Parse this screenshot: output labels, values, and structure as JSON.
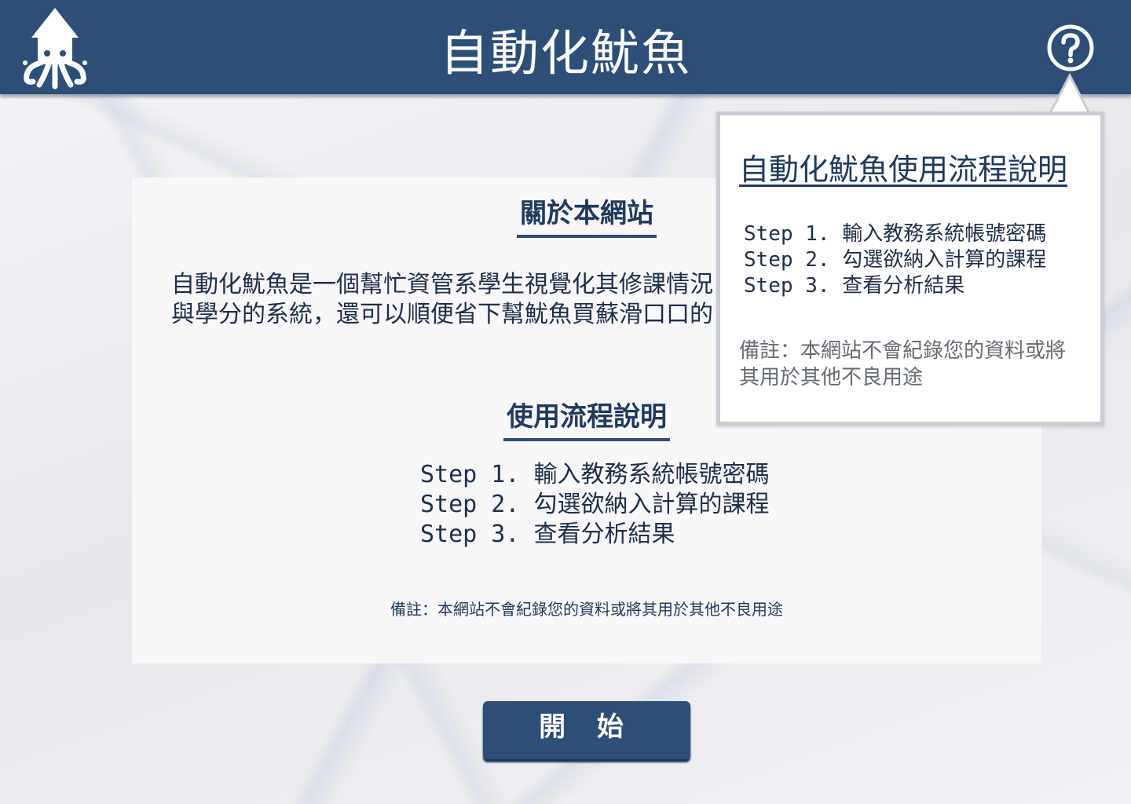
{
  "header": {
    "logo_icon": "squid-icon",
    "title": "自動化魷魚",
    "help_icon": "question-circle-icon",
    "background_color": "#2d4e76"
  },
  "card": {
    "about_title": "關於本網站",
    "about_text": "自動化魷魚是一個幫忙資管系學生視覺化其修課情況與學分的系統，還可以順便省下幫魷魚買蘇滑口口的工",
    "usage_title": "使用流程說明",
    "steps": [
      "Step 1. 輸入教務系統帳號密碼",
      "Step 2. 勾選欲納入計算的課程",
      "Step 3. 查看分析結果"
    ],
    "note": "備註：本網站不會紀錄您的資料或將其用於其他不良用途"
  },
  "start_button": {
    "label": "開 始"
  },
  "popover": {
    "title": "自動化魷魚使用流程說明",
    "steps": [
      "Step 1. 輸入教務系統帳號密碼",
      "Step 2. 勾選欲納入計算的課程",
      "Step 3. 查看分析結果"
    ],
    "note": "備註：本網站不會紀錄您的資料或將其用於其他不良用途"
  },
  "colors": {
    "primary": "#2d4e76",
    "text_dark": "#1f2f4a",
    "note_gray": "#666c76"
  }
}
